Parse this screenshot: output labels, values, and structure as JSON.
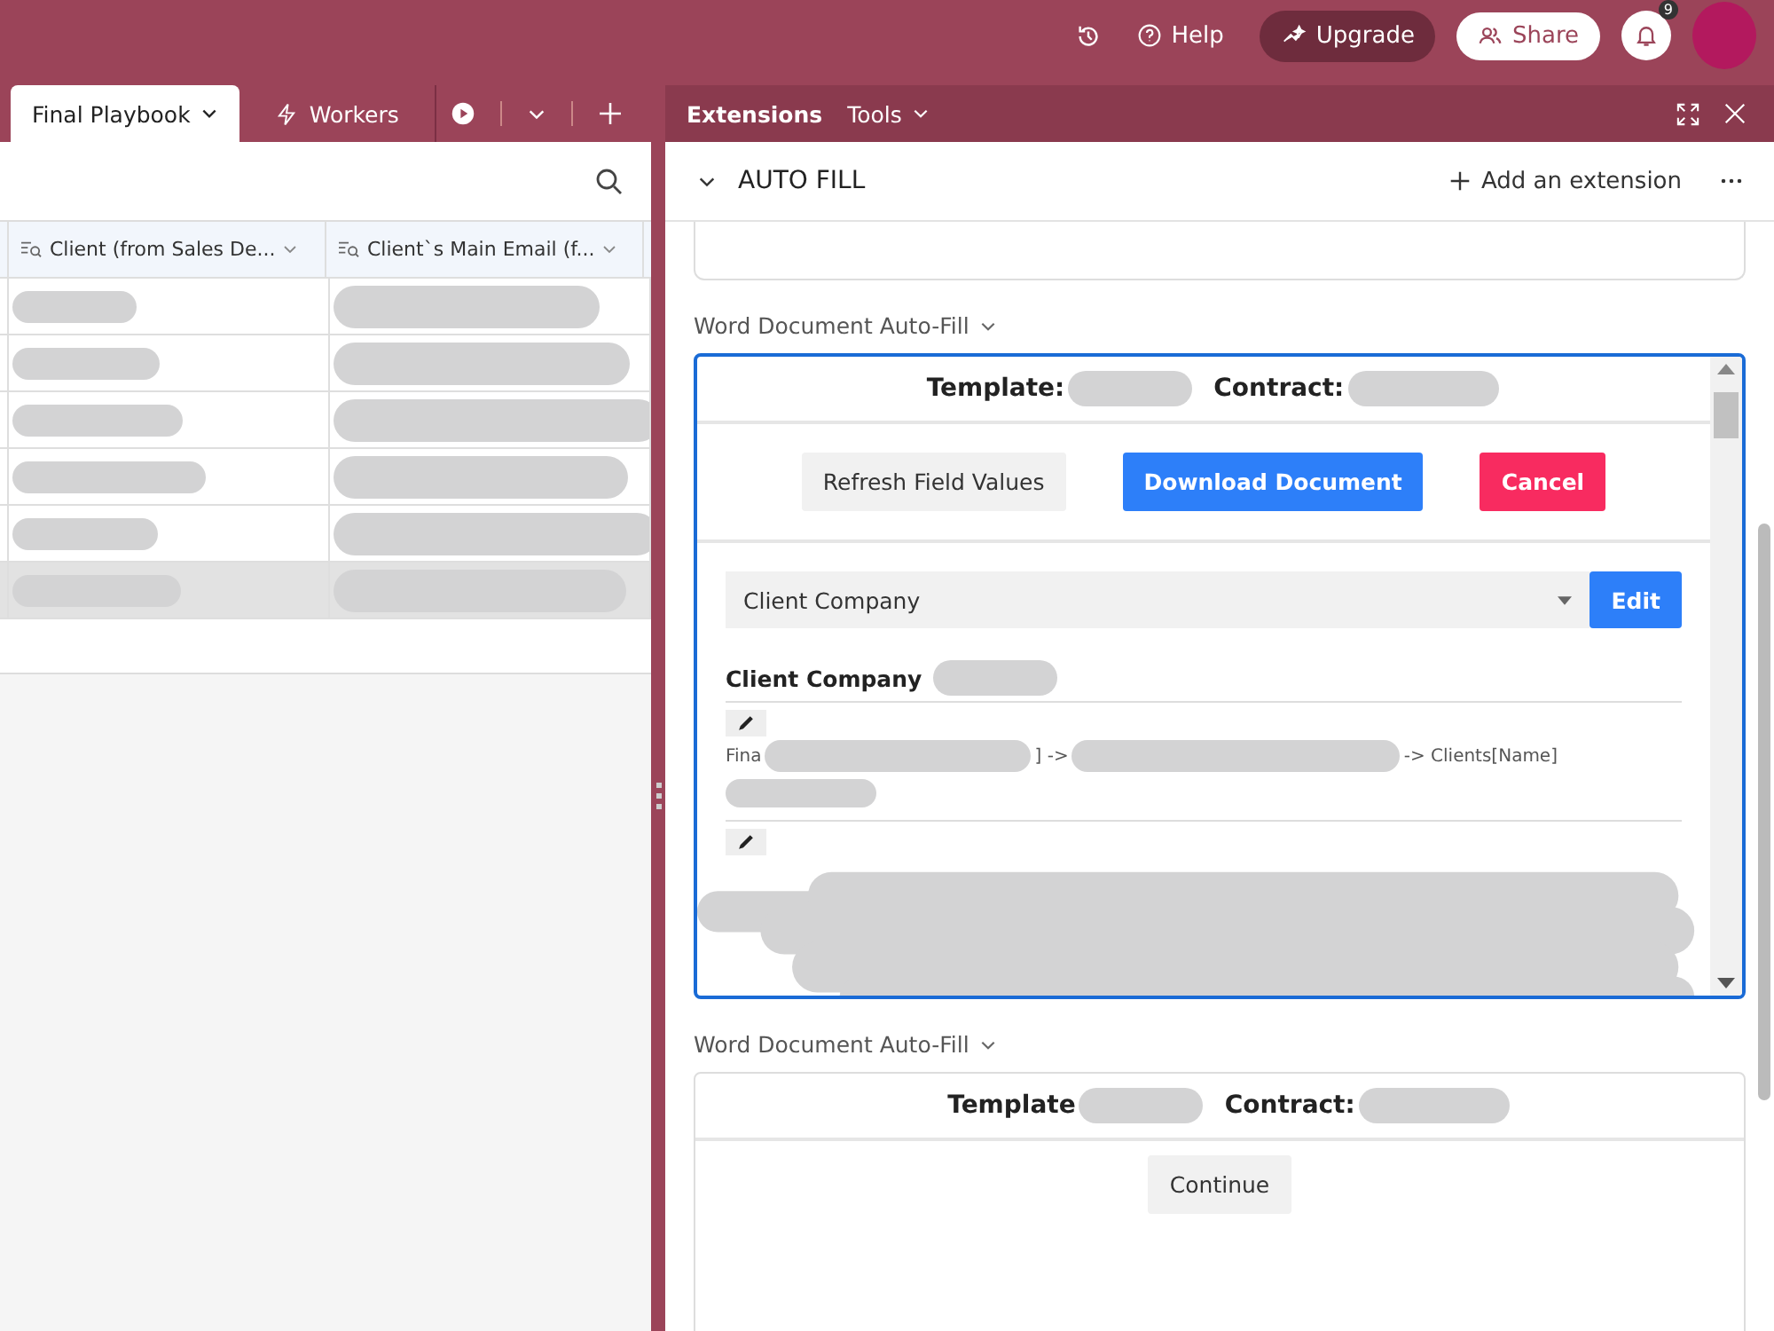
{
  "top_bar": {
    "help": "Help",
    "upgrade": "Upgrade",
    "share": "Share",
    "notification_count": "9"
  },
  "tabs": [
    {
      "label": "Final Playbook",
      "selected": true
    },
    {
      "label": "Workers",
      "selected": false
    }
  ],
  "table": {
    "columns": [
      "Client (from Sales De...",
      "Client`s Main Email (f..."
    ],
    "rows": [
      {
        "selected": false
      },
      {
        "selected": false
      },
      {
        "selected": false
      },
      {
        "selected": false
      },
      {
        "selected": false
      },
      {
        "selected": true
      }
    ]
  },
  "extensions": {
    "tabs": [
      {
        "label": "Extensions",
        "selected": true
      },
      {
        "label": "Tools",
        "selected": false
      }
    ],
    "title": "AUTO FILL",
    "add_button": "Add an extension",
    "blocks": [
      {
        "label": "Word Document Auto-Fill",
        "focused": true,
        "template_label": "Template:",
        "contract_label": "Contract:",
        "buttons": [
          {
            "label": "Refresh Field Values",
            "kind": "secondary"
          },
          {
            "label": "Download Document",
            "kind": "primary"
          },
          {
            "label": "Cancel",
            "kind": "danger"
          }
        ],
        "field_select": "Client Company",
        "edit_button": "Edit",
        "field_heading": "Client Company",
        "path_parts": [
          "Fina",
          "] ->",
          "-> Clients[Name]"
        ]
      },
      {
        "label": "Word Document Auto-Fill",
        "focused": false,
        "template_label": "Template",
        "contract_label": "Contract:",
        "buttons": [
          {
            "label": "Continue",
            "kind": "secondary"
          }
        ]
      }
    ]
  }
}
